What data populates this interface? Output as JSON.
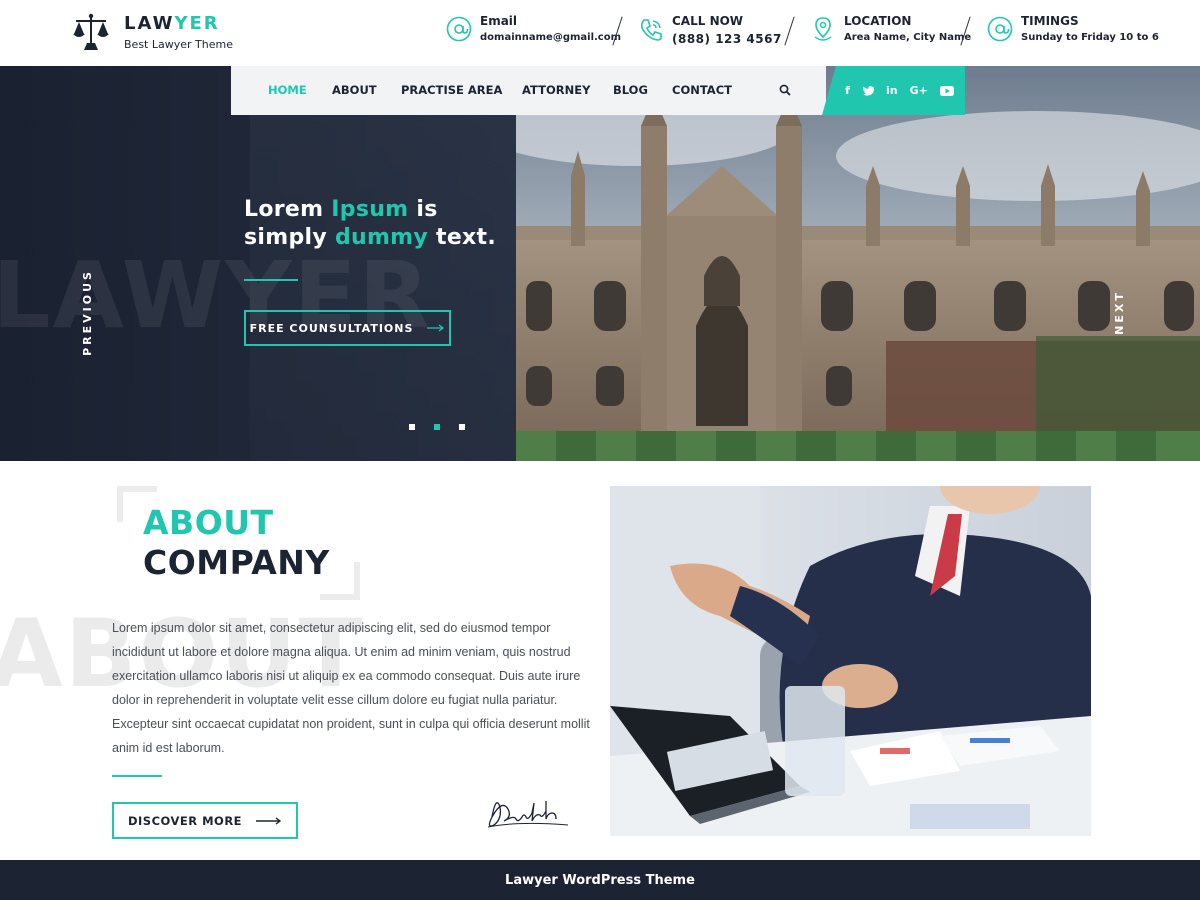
{
  "brand": {
    "name_main": "LAW",
    "name_accent": "YER",
    "tagline": "Best Lawyer Theme",
    "accent_color": "#20c7ae",
    "dark_color": "#1c2433"
  },
  "contacts": [
    {
      "icon": "at-icon",
      "label": "Email",
      "value": "domainname@gmail.com"
    },
    {
      "icon": "phone-icon",
      "label": "CALL NOW",
      "value": "(888) 123 4567"
    },
    {
      "icon": "location-pin-icon",
      "label": "LOCATION",
      "value": "Area Name, City Name"
    },
    {
      "icon": "at-icon",
      "label": "TIMINGS",
      "value": "Sunday to Friday 10 to 6"
    }
  ],
  "nav": {
    "items": [
      "HOME",
      "ABOUT",
      "PRACTISE AREA",
      "ATTORNEY",
      "BLOG",
      "CONTACT"
    ],
    "active": "HOME"
  },
  "social": [
    "f",
    "twitter",
    "in",
    "G+",
    "youtube"
  ],
  "hero": {
    "watermark": "LAWYER",
    "headline_1a": "Lorem ",
    "headline_1b": "Ipsum",
    "headline_1c": " is",
    "headline_2a": "simply ",
    "headline_2b": "dummy",
    "headline_2c": " text.",
    "button": "FREE COUNSULTATIONS",
    "prev_label": "PREVIOUS",
    "next_label": "NEXT",
    "slides": 3,
    "active_slide": 2
  },
  "about": {
    "title_1": "ABOUT",
    "title_2": "COMPANY",
    "watermark": "ABOUT",
    "body": "Lorem ipsum dolor sit amet, consectetur adipiscing elit, sed do eiusmod tempor incididunt ut labore et dolore magna aliqua. Ut enim ad minim veniam, quis nostrud exercitation ullamco laboris nisi ut aliquip ex ea commodo consequat. Duis aute irure dolor in reprehenderit in voluptate velit esse cillum dolore eu fugiat nulla pariatur. Excepteur sint occaecat cupidatat non proident, sunt in culpa qui officia deserunt mollit anim id est laborum.",
    "button": "DISCOVER MORE"
  },
  "footer": {
    "text": "Lawyer WordPress Theme"
  }
}
